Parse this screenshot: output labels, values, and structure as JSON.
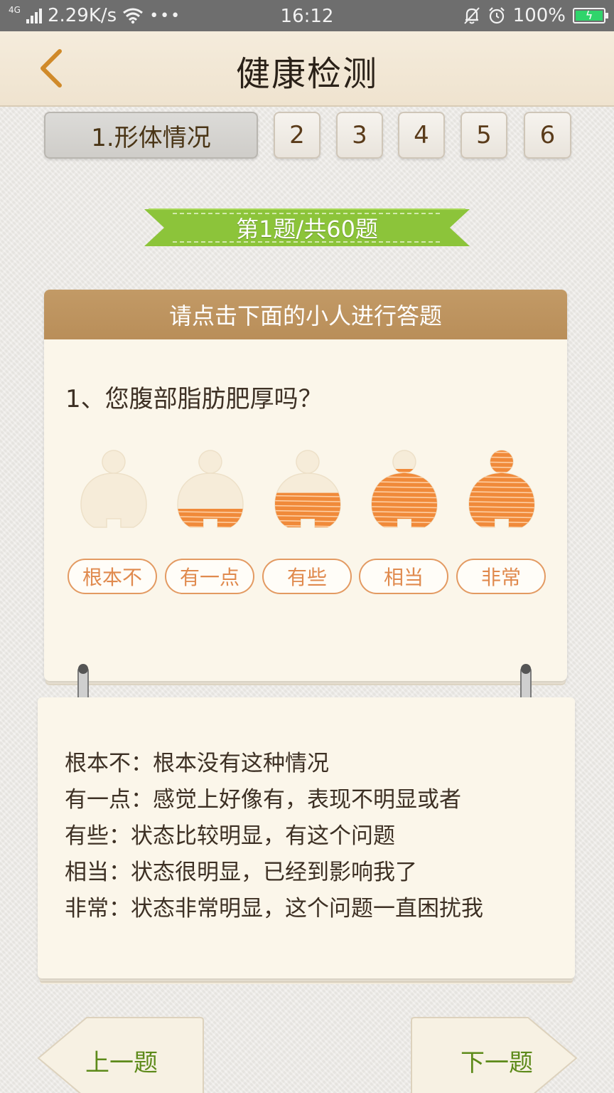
{
  "status_bar": {
    "network": "4G",
    "speed": "2.29K/s",
    "dots": "•••",
    "time": "16:12",
    "battery": "100%",
    "icons": [
      "signal-icon",
      "wifi-icon",
      "bell-off-icon",
      "alarm-icon",
      "battery-charging-icon"
    ]
  },
  "header": {
    "title": "健康检测",
    "back_icon": "chevron-left-icon",
    "accent_color": "#d08a2a"
  },
  "tabs": [
    {
      "label": "1.形体情况",
      "active": true
    },
    {
      "label": "2",
      "active": false
    },
    {
      "label": "3",
      "active": false
    },
    {
      "label": "4",
      "active": false
    },
    {
      "label": "5",
      "active": false
    },
    {
      "label": "6",
      "active": false
    }
  ],
  "progress": {
    "label": "第1题/共60题",
    "ribbon_color": "#8cc43a"
  },
  "question_card": {
    "header": "请点击下面的小人进行答题",
    "question": "1、您腹部脂肪肥厚吗？",
    "options": [
      {
        "label": "根本不",
        "fill_level": 0
      },
      {
        "label": "有一点",
        "fill_level": 0.25
      },
      {
        "label": "有些",
        "fill_level": 0.45
      },
      {
        "label": "相当",
        "fill_level": 0.75
      },
      {
        "label": "非常",
        "fill_level": 1.0
      }
    ],
    "figure_color": "#f08a3a",
    "option_color": "#e08a4e"
  },
  "explanation": {
    "lines": [
      "根本不：根本没有这种情况",
      "有一点：感觉上好像有，表现不明显或者",
      "有些：状态比较明显，有这个问题",
      "相当：状态很明显，已经到影响我了",
      "非常：状态非常明显，这个问题一直困扰我"
    ]
  },
  "nav": {
    "prev_label": "上一题",
    "next_label": "下一题",
    "text_color": "#5d8a1a"
  }
}
